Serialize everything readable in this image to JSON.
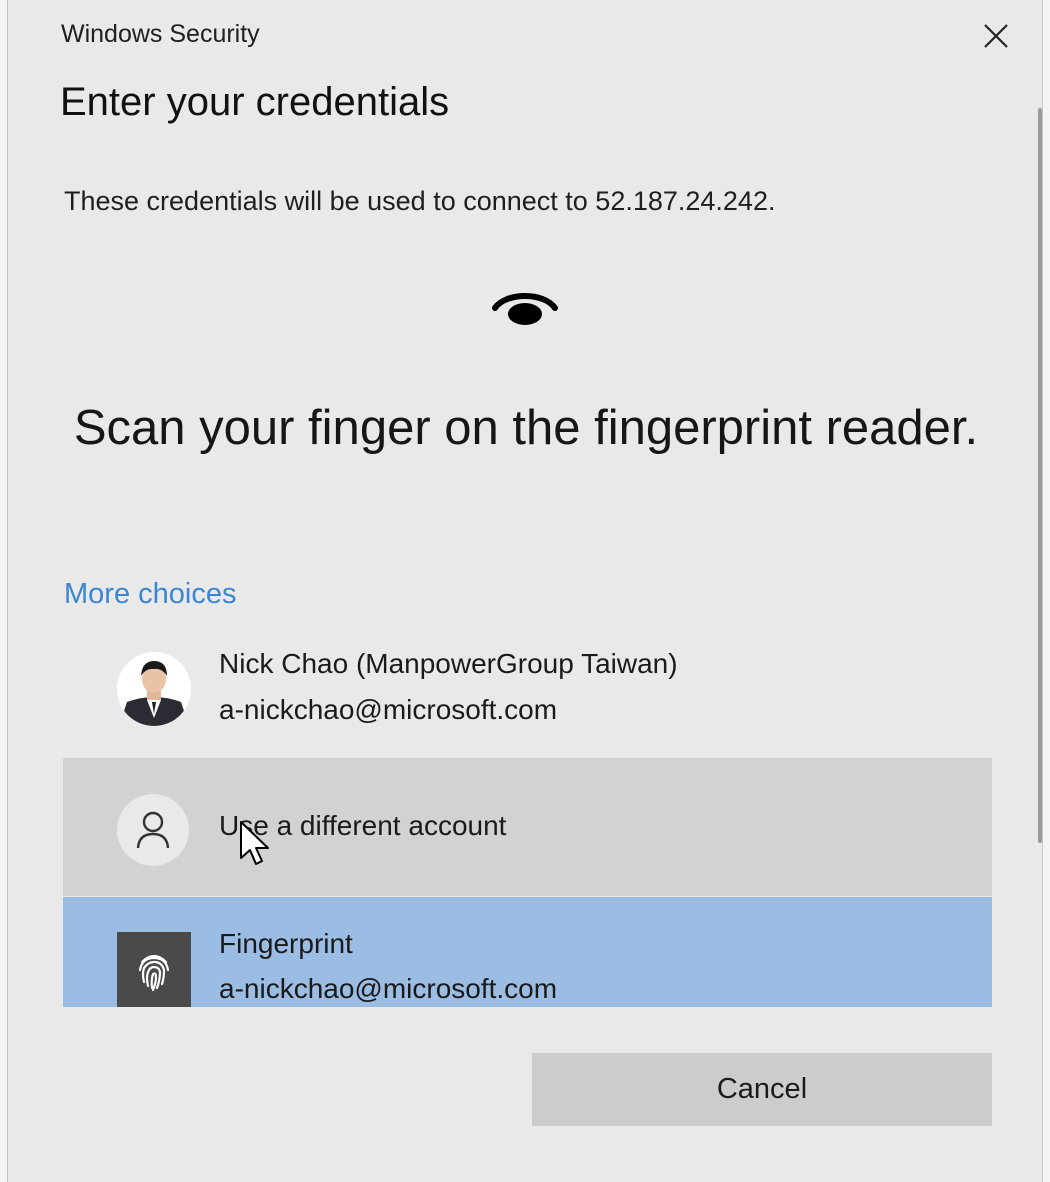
{
  "window": {
    "title": "Windows Security"
  },
  "dialog": {
    "heading": "Enter your credentials",
    "description": "These credentials will be used to connect to 52.187.24.242.",
    "prompt": "Scan your finger on the fingerprint reader.",
    "more_choices_label": "More choices"
  },
  "accounts": [
    {
      "name": "Nick Chao (ManpowerGroup Taiwan)",
      "email": "a-nickchao@microsoft.com",
      "icon": "user-photo-avatar"
    },
    {
      "name": "Use a different account",
      "icon": "person-icon"
    },
    {
      "name": "Fingerprint",
      "email": "a-nickchao@microsoft.com",
      "icon": "fingerprint-icon",
      "selected": true
    }
  ],
  "buttons": {
    "cancel_label": "Cancel"
  },
  "colors": {
    "link": "#3b86d1",
    "selected_row": "#9cbde3",
    "hover_row": "#d2d2d2",
    "dialog_bg": "#e9e9e9"
  }
}
